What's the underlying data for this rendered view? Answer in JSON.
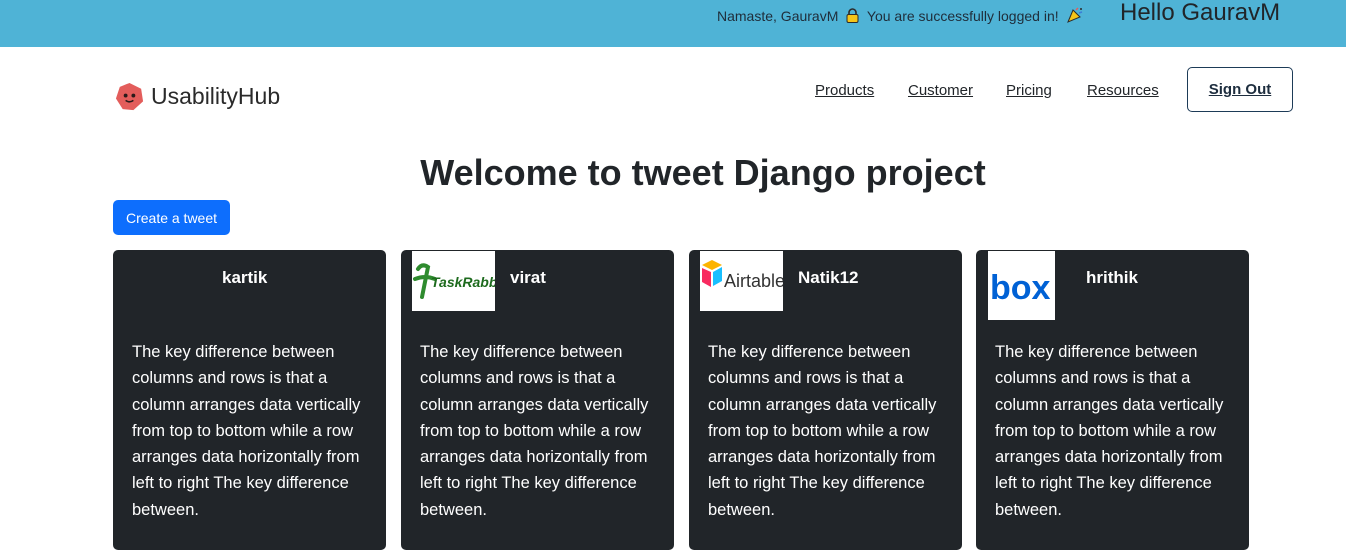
{
  "banner": {
    "greeting_prefix": "Namaste, GauravM",
    "greeting_suffix": "You are successfully logged in!",
    "hello": "Hello GauravM",
    "background": "#4fb3d6"
  },
  "brand": {
    "name": "UsabilityHub",
    "logo_icon": "hexagon-face-logo",
    "logo_color": "#e35d5b"
  },
  "nav": {
    "items": [
      "Products",
      "Customer",
      "Pricing",
      "Resources"
    ],
    "sign_out": "Sign Out"
  },
  "main": {
    "title": "Welcome to tweet Django project",
    "create_button": "Create a tweet",
    "accent": "#0d6efd"
  },
  "tweets": [
    {
      "user": "kartik",
      "logo": "none",
      "text": "The key difference between columns and rows is that a column arranges data vertically from top to bottom while a row arranges data horizontally from left to right The key difference between."
    },
    {
      "user": "virat",
      "logo": "TaskRabbit",
      "text": "The key difference between columns and rows is that a column arranges data vertically from top to bottom while a row arranges data horizontally from left to right The key difference between."
    },
    {
      "user": "Natik12",
      "logo": "Airtable",
      "text": "The key difference between columns and rows is that a column arranges data vertically from top to bottom while a row arranges data horizontally from left to right The key difference between."
    },
    {
      "user": "hrithik",
      "logo": "box",
      "text": "The key difference between columns and rows is that a column arranges data vertically from top to bottom while a row arranges data horizontally from left to right The key difference between."
    }
  ]
}
